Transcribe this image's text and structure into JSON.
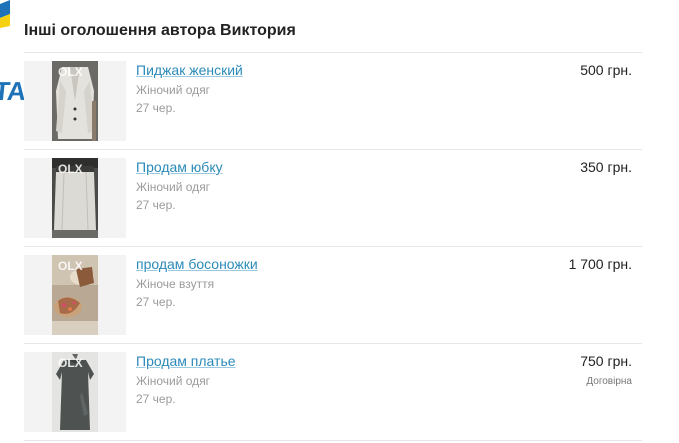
{
  "heading": "Інші оголошення автора Виктория",
  "banner_fragment": "ТА!",
  "watermark": "OLX",
  "colors": {
    "link": "#2b8ab9",
    "banner_blue": "#1e72b8",
    "flag_yellow": "#f5d10f"
  },
  "listings": [
    {
      "title": "Пиджак женский",
      "category": "Жіночий одяг",
      "date": "27 чер.",
      "price": "500 грн.",
      "negotiable": "",
      "thumb": "jacket-photo"
    },
    {
      "title": "Продам юбку",
      "category": "Жіночий одяг",
      "date": "27 чер.",
      "price": "350 грн.",
      "negotiable": "",
      "thumb": "skirt-photo"
    },
    {
      "title": "продам босоножки",
      "category": "Жіноче взуття",
      "date": "27 чер.",
      "price": "1 700 грн.",
      "negotiable": "",
      "thumb": "sandals-photo"
    },
    {
      "title": "Продам платье",
      "category": "Жіночий одяг",
      "date": "27 чер.",
      "price": "750 грн.",
      "negotiable": "Договірна",
      "thumb": "dress-photo"
    }
  ]
}
